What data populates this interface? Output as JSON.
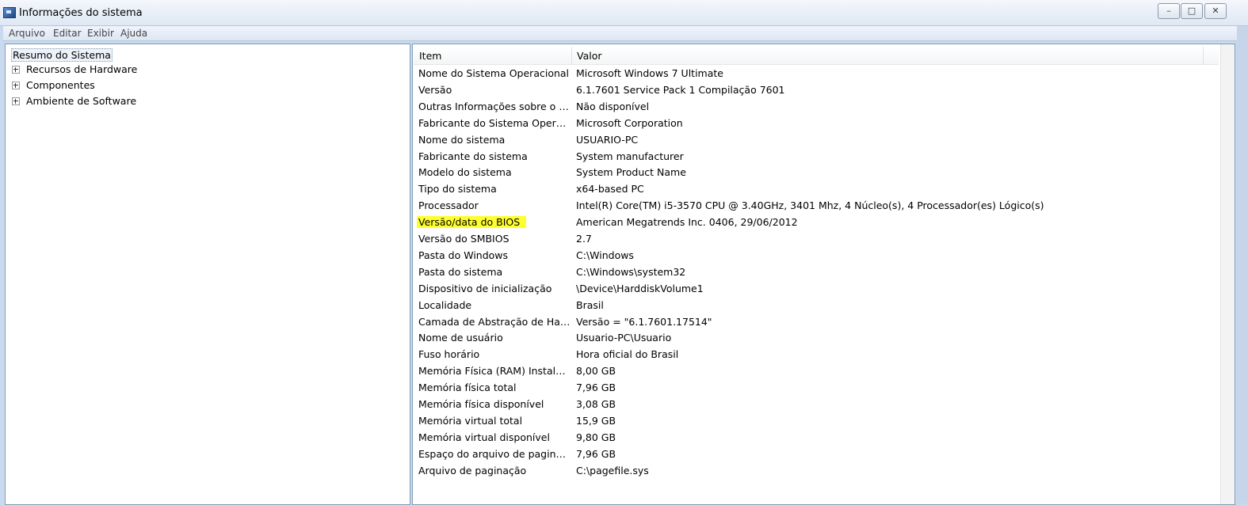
{
  "window": {
    "title": "Informações do sistema"
  },
  "menu": [
    {
      "label": "Arquivo",
      "id": "arquivo"
    },
    {
      "label": "Editar",
      "id": "editar"
    },
    {
      "label": "Exibir",
      "id": "exibir"
    },
    {
      "label": "Ajuda",
      "id": "ajuda"
    }
  ],
  "tree": {
    "root": "Resumo do Sistema",
    "children": [
      "Recursos de Hardware",
      "Componentes",
      "Ambiente de Software"
    ]
  },
  "table": {
    "headers": {
      "item": "Item",
      "value": "Valor"
    },
    "highlight_color": "#ffff2e",
    "rows": [
      {
        "item": "Nome do Sistema Operacional",
        "value": "Microsoft Windows 7 Ultimate"
      },
      {
        "item": "Versão",
        "value": "6.1.7601 Service Pack 1 Compilação 7601"
      },
      {
        "item": "Outras Informações sobre o Si...",
        "value": "Não disponível"
      },
      {
        "item": "Fabricante do Sistema Operaci...",
        "value": "Microsoft Corporation"
      },
      {
        "item": "Nome do sistema",
        "value": "USUARIO-PC"
      },
      {
        "item": "Fabricante do sistema",
        "value": "System manufacturer"
      },
      {
        "item": "Modelo do sistema",
        "value": "System Product Name"
      },
      {
        "item": "Tipo do sistema",
        "value": "x64-based PC"
      },
      {
        "item": "Processador",
        "value": "Intel(R) Core(TM) i5-3570 CPU @ 3.40GHz, 3401 Mhz, 4 Núcleo(s), 4 Processador(es) Lógico(s)"
      },
      {
        "item": "Versão/data do BIOS",
        "value": "American Megatrends Inc. 0406, 29/06/2012",
        "highlighted": true
      },
      {
        "item": "Versão do SMBIOS",
        "value": "2.7"
      },
      {
        "item": "Pasta do Windows",
        "value": "C:\\Windows"
      },
      {
        "item": "Pasta do sistema",
        "value": "C:\\Windows\\system32"
      },
      {
        "item": "Dispositivo de inicialização",
        "value": "\\Device\\HarddiskVolume1"
      },
      {
        "item": "Localidade",
        "value": "Brasil"
      },
      {
        "item": "Camada de Abstração de Hard...",
        "value": "Versão = \"6.1.7601.17514\""
      },
      {
        "item": "Nome de usuário",
        "value": "Usuario-PC\\Usuario"
      },
      {
        "item": "Fuso horário",
        "value": "Hora oficial do Brasil"
      },
      {
        "item": "Memória Física (RAM) Instalada",
        "value": "8,00 GB"
      },
      {
        "item": "Memória física total",
        "value": "7,96 GB"
      },
      {
        "item": "Memória física disponível",
        "value": "3,08 GB"
      },
      {
        "item": "Memória virtual total",
        "value": "15,9 GB"
      },
      {
        "item": "Memória virtual disponível",
        "value": "9,80 GB"
      },
      {
        "item": "Espaço do arquivo de paginaç...",
        "value": "7,96 GB"
      },
      {
        "item": "Arquivo de paginação",
        "value": "C:\\pagefile.sys"
      }
    ]
  }
}
